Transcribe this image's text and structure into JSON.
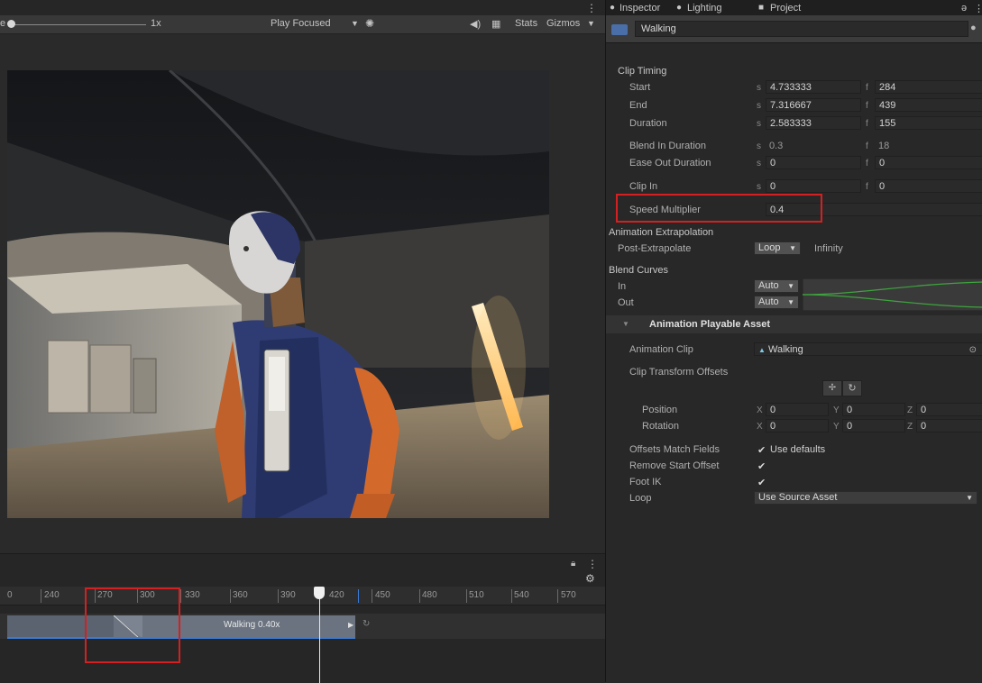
{
  "game_view": {
    "scale_label": "e",
    "scale_value": "1x",
    "play_mode": "Play Focused",
    "stats_label": "Stats",
    "gizmos_label": "Gizmos"
  },
  "timeline": {
    "ruler_ticks": [
      "0",
      "240",
      "270",
      "300",
      "330",
      "360",
      "390",
      "420",
      "450",
      "480",
      "510",
      "540",
      "570"
    ],
    "clip_label": "Walking 0.40x"
  },
  "inspector": {
    "tabs": {
      "inspector": "Inspector",
      "lighting": "Lighting",
      "project": "Project"
    },
    "clip_name": "Walking",
    "clip_timing": {
      "header": "Clip Timing",
      "start_label": "Start",
      "start_s": "4.733333",
      "start_f": "284",
      "end_label": "End",
      "end_s": "7.316667",
      "end_f": "439",
      "duration_label": "Duration",
      "duration_s": "2.583333",
      "duration_f": "155",
      "blend_in_label": "Blend In Duration",
      "blend_in_s": "0.3",
      "blend_in_f": "18",
      "ease_out_label": "Ease Out Duration",
      "ease_out_s": "0",
      "ease_out_f": "0",
      "clip_in_label": "Clip In",
      "clip_in_s": "0",
      "clip_in_f": "0",
      "speed_label": "Speed Multiplier",
      "speed_value": "0.4",
      "unit_s": "s",
      "unit_f": "f"
    },
    "extrapolation": {
      "header": "Animation Extrapolation",
      "post_label": "Post-Extrapolate",
      "post_value": "Loop",
      "post_result": "Infinity"
    },
    "blend_curves": {
      "header": "Blend Curves",
      "in_label": "In",
      "in_value": "Auto",
      "out_label": "Out",
      "out_value": "Auto"
    },
    "playable_asset": {
      "header": "Animation Playable Asset",
      "clip_label": "Animation Clip",
      "clip_value": "Walking",
      "offsets_label": "Clip Transform Offsets",
      "position_label": "Position",
      "rotation_label": "Rotation",
      "axis_x": "X",
      "axis_y": "Y",
      "axis_z": "Z",
      "pos_x": "0",
      "pos_y": "0",
      "pos_z": "0",
      "rot_x": "0",
      "rot_y": "0",
      "rot_z": "0",
      "match_label": "Offsets Match Fields",
      "match_value": "Use defaults",
      "remove_label": "Remove Start Offset",
      "footik_label": "Foot IK",
      "loop_label": "Loop",
      "loop_value": "Use Source Asset"
    }
  }
}
